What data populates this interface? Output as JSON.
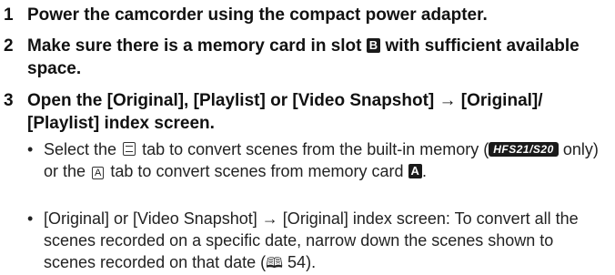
{
  "steps": [
    {
      "num": "1",
      "text": "Power the camcorder using the compact power adapter."
    },
    {
      "num": "2",
      "text_a": "Make sure there is a memory card in slot",
      "slot": "B",
      "text_b": "with sufficient available space."
    },
    {
      "num": "3",
      "text": "Open the [Original], [Playlist] or [Video Snapshot] → [Original]/ [Playlist] index screen."
    }
  ],
  "bullets": [
    {
      "dot": "•",
      "a": "Select the",
      "tab_icon": "built-in-memory-tab-icon",
      "b": "tab to convert scenes from the built-in memory (",
      "model_badge": "HFS21/S20",
      "c": "only) or the",
      "tab_letter": "A",
      "d": "tab to convert scenes from memory card",
      "card_letter": "A",
      "e": "."
    },
    {
      "dot": "•",
      "a": "[Original] or [Video Snapshot] → [Original] index screen: To convert all the scenes recorded on a specific date, narrow down the scenes shown to scenes recorded on that date (",
      "ref_icon": "book-reference-icon",
      "ref_page": "54",
      "b": ")."
    }
  ]
}
